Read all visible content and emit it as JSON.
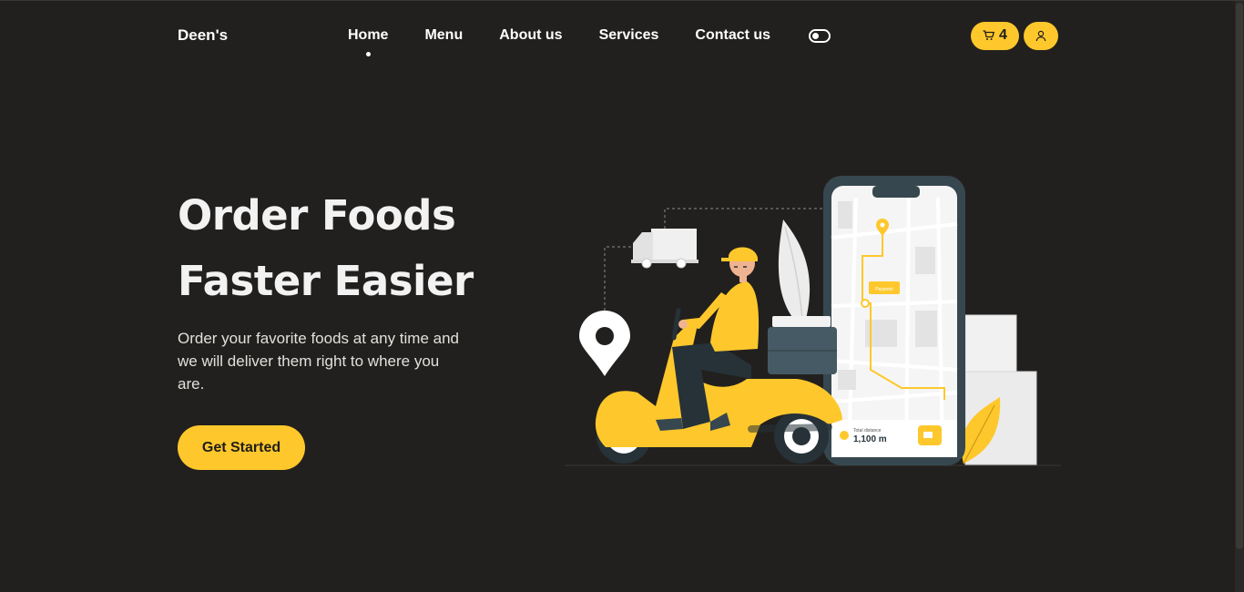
{
  "brand": "Deen's",
  "nav": {
    "items": [
      {
        "label": "Home",
        "active": true
      },
      {
        "label": "Menu"
      },
      {
        "label": "About us"
      },
      {
        "label": "Services"
      },
      {
        "label": "Contact us"
      }
    ]
  },
  "cart": {
    "count": "4",
    "icon": "cart-icon"
  },
  "user": {
    "icon": "user-icon"
  },
  "theme_toggle": {
    "icon": "toggle-icon"
  },
  "hero": {
    "title_line1": "Order Foods",
    "title_line2": "Faster Easier",
    "description": "Order your favorite foods at any time and we will deliver them right to where you are.",
    "cta_label": "Get Started"
  },
  "illustration": {
    "distance_label": "Total distance",
    "distance_value": "1,100 m",
    "map_tag": "Paypoint"
  },
  "colors": {
    "background": "#22201e",
    "accent": "#fec82c",
    "text": "#ffffff"
  }
}
